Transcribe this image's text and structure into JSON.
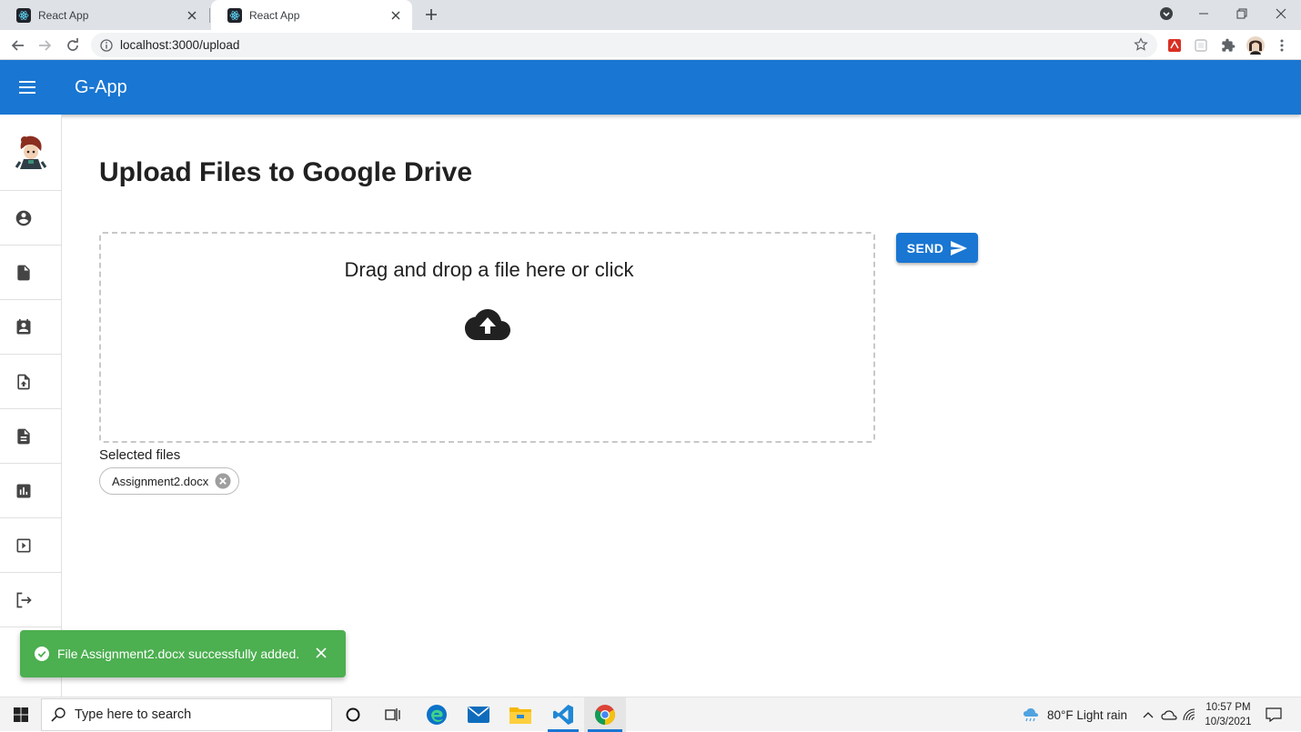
{
  "browser": {
    "tabs": [
      {
        "title": "React App",
        "active": false
      },
      {
        "title": "React App",
        "active": true
      }
    ],
    "address": "localhost:3000/upload"
  },
  "app": {
    "title": "G-App",
    "brand_color": "#1976d2"
  },
  "drawer": {
    "items": [
      {
        "icon": "avatar-icon"
      },
      {
        "icon": "account-circle-icon"
      },
      {
        "icon": "file-icon"
      },
      {
        "icon": "contact-card-icon"
      },
      {
        "icon": "upload-file-icon"
      },
      {
        "icon": "document-icon"
      },
      {
        "icon": "bar-chart-icon"
      },
      {
        "icon": "play-slides-icon"
      },
      {
        "icon": "logout-icon"
      }
    ]
  },
  "main": {
    "title": "Upload Files to Google Drive",
    "dropzone_text": "Drag and drop a file here or click",
    "send_label": "SEND",
    "selected_label": "Selected files",
    "selected_files": [
      "Assignment2.docx"
    ]
  },
  "snackbar": {
    "message": "File Assignment2.docx successfully added.",
    "color": "#4caf50"
  },
  "taskbar": {
    "search_placeholder": "Type here to search",
    "weather": "80°F  Light rain",
    "time": "10:57 PM",
    "date": "10/3/2021"
  }
}
